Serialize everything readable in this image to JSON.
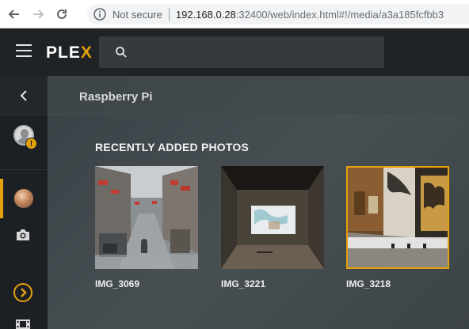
{
  "browser": {
    "security_label": "Not secure",
    "url_host": "192.168.0.28",
    "url_rest": ":32400/web/index.html#!/media/a3a185fcfbb3"
  },
  "header": {
    "logo_text": "PLE",
    "logo_accent": "X",
    "search_placeholder": ""
  },
  "sidebar": {
    "items": [
      {
        "icon": "back-arrow-icon"
      },
      {
        "icon": "user-avatar-icon",
        "badge": "!"
      },
      {
        "icon": "photo-library-icon",
        "active": true
      },
      {
        "icon": "camera-icon"
      },
      {
        "icon": "chevron-right-icon"
      },
      {
        "icon": "film-icon"
      }
    ]
  },
  "content": {
    "server_name": "Raspberry Pi",
    "section_title": "RECENTLY ADDED PHOTOS",
    "photos": [
      {
        "label": "IMG_3069"
      },
      {
        "label": "IMG_3221"
      },
      {
        "label": "IMG_3218",
        "selected": true
      }
    ]
  },
  "colors": {
    "accent": "#e5a00d",
    "header_bg": "#1f2326",
    "sidebar_bg": "#1c2024"
  }
}
